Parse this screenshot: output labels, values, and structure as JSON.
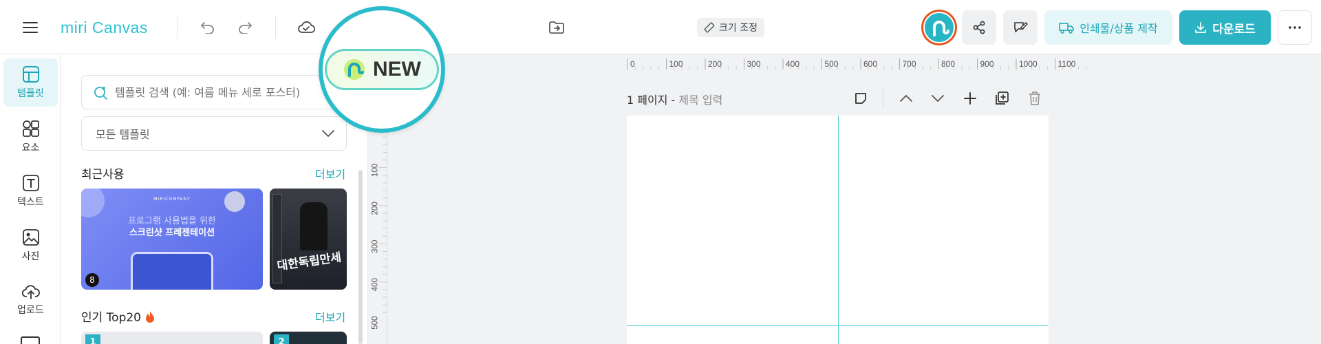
{
  "topbar": {
    "logo_text": "miri Canvas",
    "resize_label": "크기 조정",
    "print_label": "인쇄물/상품 제작",
    "download_label": "다운로드"
  },
  "nav": {
    "items": [
      {
        "label": "템플릿",
        "icon": "template-icon",
        "active": true
      },
      {
        "label": "요소",
        "icon": "elements-icon",
        "active": false
      },
      {
        "label": "텍스트",
        "icon": "text-icon",
        "active": false
      },
      {
        "label": "사진",
        "icon": "photo-icon",
        "active": false
      },
      {
        "label": "업로드",
        "icon": "upload-icon",
        "active": false
      }
    ]
  },
  "panel": {
    "search_placeholder": "템플릿 검색 (예: 여름 메뉴 세로 포스터)",
    "filter_value": "모든 템플릿",
    "recent": {
      "title": "최근사용",
      "more": "더보기"
    },
    "popular": {
      "title": "인기 Top20",
      "more": "더보기"
    },
    "thumb1": {
      "brand": "MIRICOMPANY",
      "line1": "프로그램 사용법을 위한",
      "line2": "스크린샷 프레젠테이션",
      "badge": "8"
    },
    "thumb2": {
      "text": "대한독립만세"
    },
    "rank1": "1",
    "rank2": "2"
  },
  "callout": {
    "label": "NEW"
  },
  "ruler": {
    "h_ticks": [
      "0",
      "100",
      "200",
      "300",
      "400",
      "500",
      "600",
      "700",
      "800",
      "900",
      "1000",
      "1100"
    ],
    "v_ticks": [
      "100",
      "200",
      "300",
      "400",
      "500"
    ]
  },
  "page": {
    "number_label": "1 페이지 -",
    "title_placeholder": "제목 입력"
  },
  "colors": {
    "accent": "#2bb3c4",
    "accent_light": "#e5f6f8",
    "avatar_ring": "#e5541d"
  }
}
